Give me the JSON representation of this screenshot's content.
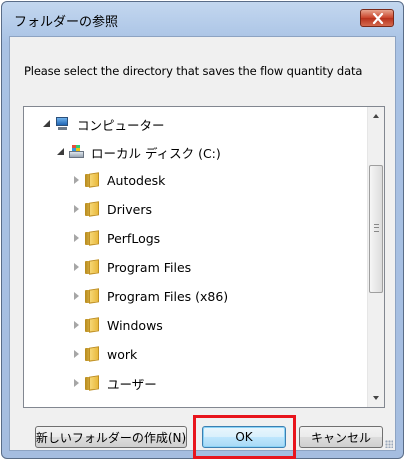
{
  "window": {
    "title": "フォルダーの参照"
  },
  "prompt": "Please select the directory that saves the flow quantity data",
  "tree": {
    "root": {
      "label": "コンピューター",
      "icon": "computer-icon"
    },
    "drive": {
      "label": "ローカル ディスク (C:)",
      "icon": "drive-icon"
    },
    "folders": [
      {
        "label": "Autodesk"
      },
      {
        "label": "Drivers"
      },
      {
        "label": "PerfLogs"
      },
      {
        "label": "Program Files"
      },
      {
        "label": "Program Files (x86)"
      },
      {
        "label": "Windows"
      },
      {
        "label": "work",
        "selected": true
      },
      {
        "label": "ユーザー"
      }
    ]
  },
  "buttons": {
    "new_folder": "新しいフォルダーの作成(N)",
    "ok": "OK",
    "cancel": "キャンセル"
  },
  "colors": {
    "highlight": "#e8141c",
    "close": "#c9432a"
  }
}
